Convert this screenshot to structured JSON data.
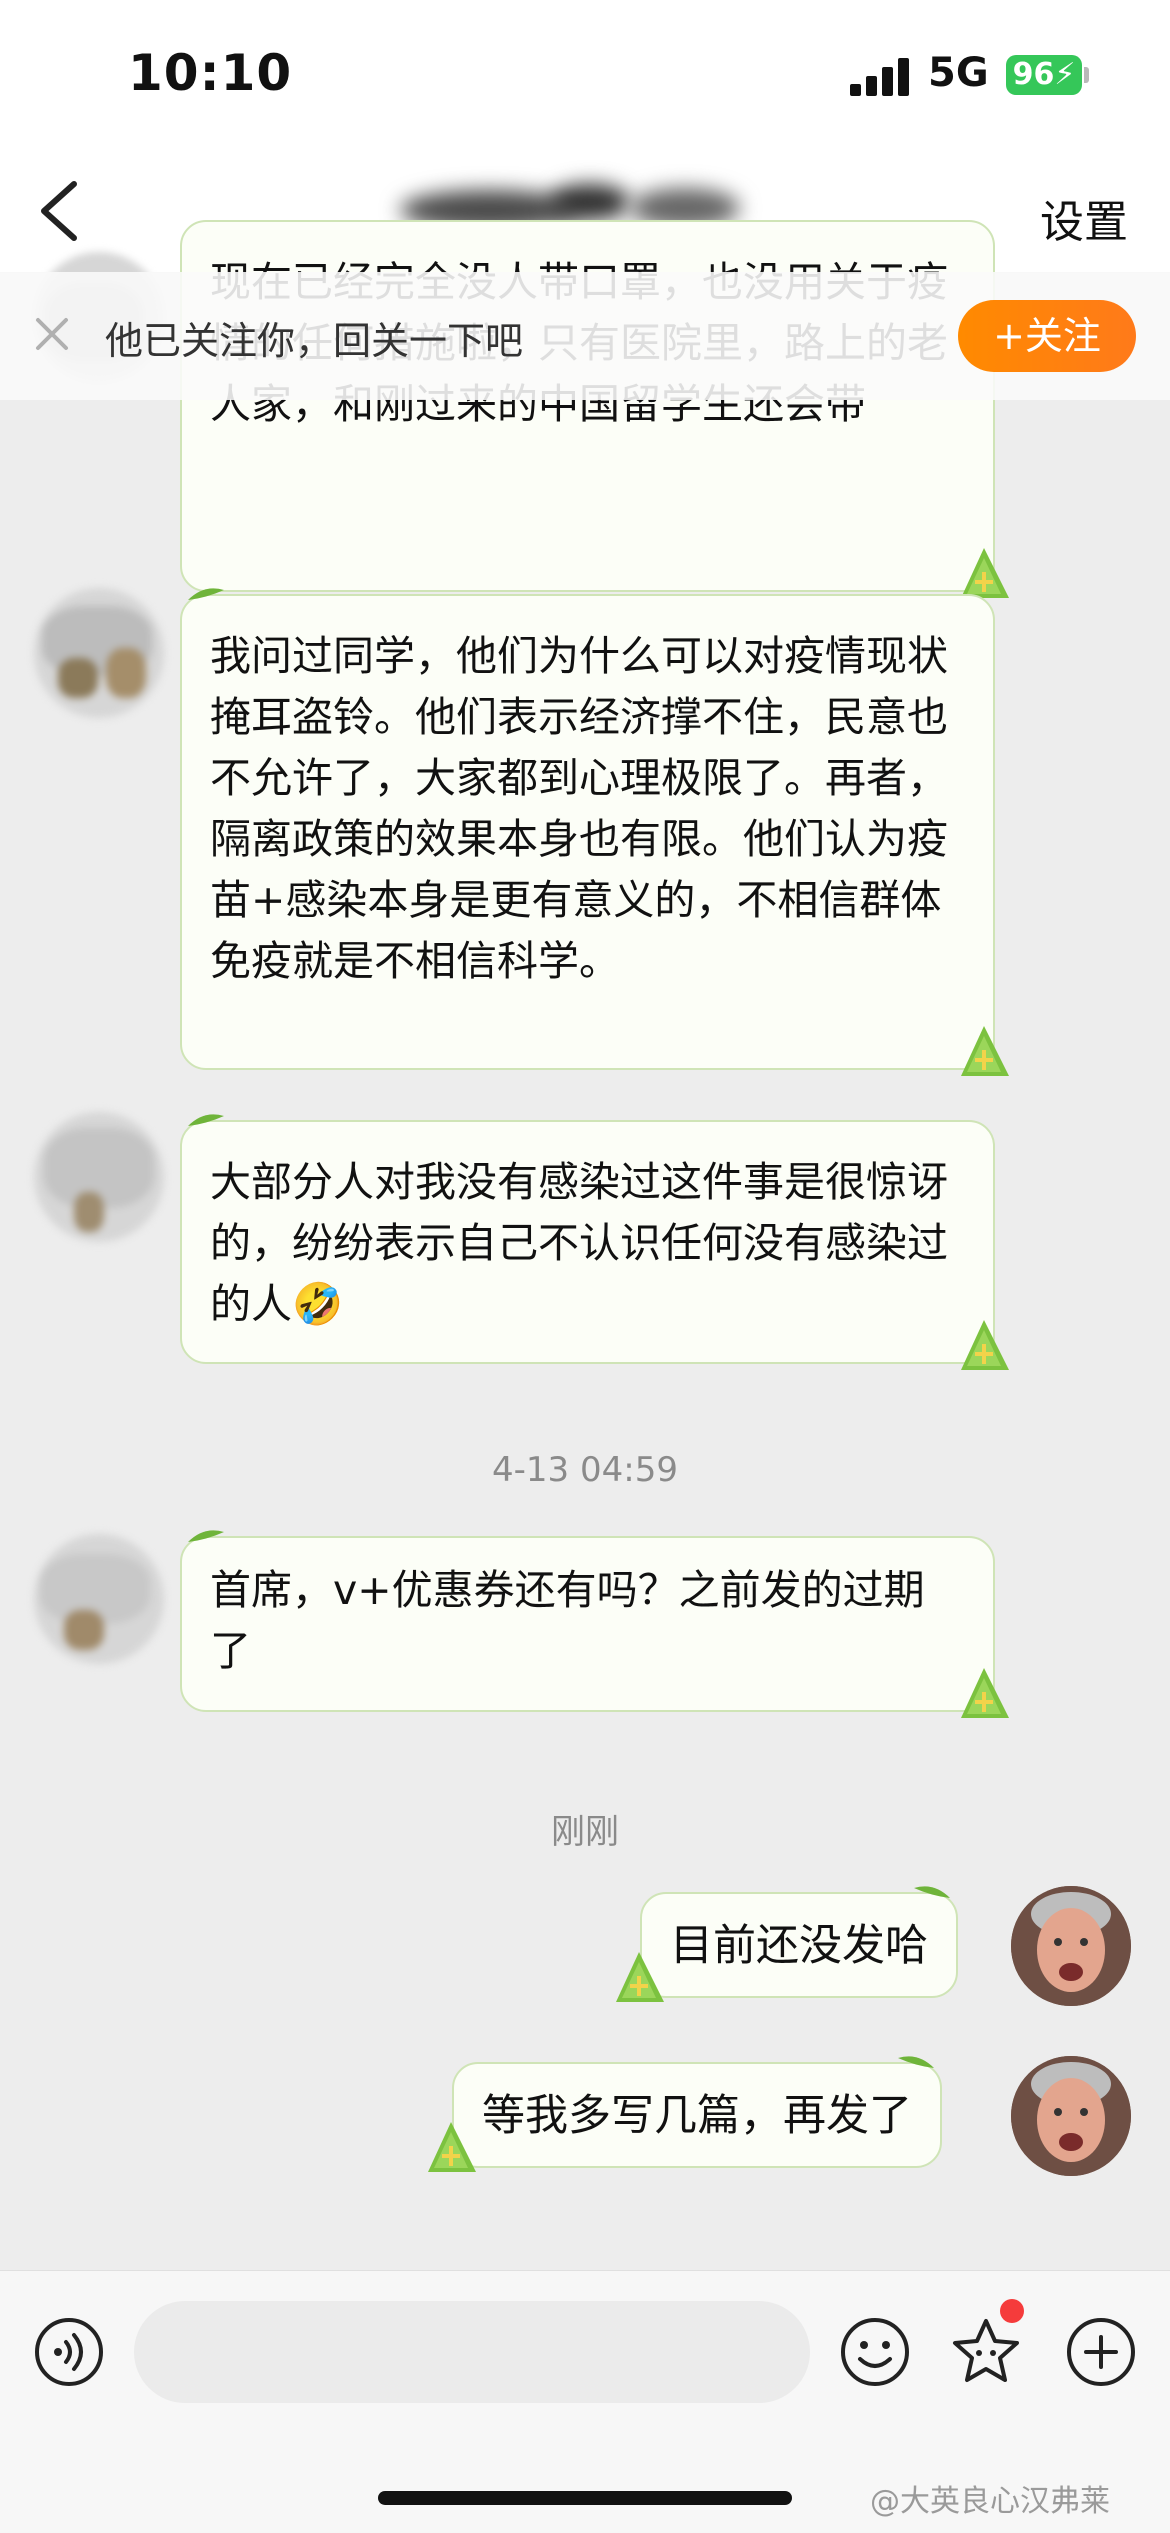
{
  "status_bar": {
    "time": "10:10",
    "network": "5G",
    "battery": "96"
  },
  "nav": {
    "settings_label": "设置"
  },
  "follow_banner": {
    "text": "他已关注你，回关一下吧",
    "follow_button": "+关注"
  },
  "messages_in": [
    {
      "text": "现在已经完全没人带口罩，也没用关于疫情的任何措施啦，只有医院里，路上的老人家，和刚过来的中国留学生还会带"
    },
    {
      "text": "我问过同学，他们为什么可以对疫情现状掩耳盗铃。他们表示经济撑不住，民意也不允许了，大家都到心理极限了。再者，隔离政策的效果本身也有限。他们认为疫苗+感染本身是更有意义的，不相信群体免疫就是不相信科学。"
    },
    {
      "text": "大部分人对我没有感染过这件事是很惊讶的，纷纷表示自己不认识任何没有感染过的人🤣"
    },
    {
      "text": "首席，v+优惠券还有吗？之前发的过期了"
    }
  ],
  "timestamps": [
    "4-13 04:59",
    "刚刚"
  ],
  "messages_out": [
    {
      "text": "目前还没发哈"
    },
    {
      "text": "等我多写几篇，再发了"
    }
  ],
  "input": {
    "placeholder": ""
  },
  "watermark": "@大英良心汉弗莱",
  "colors": {
    "bubble_bg": "#fcfef7",
    "bubble_border": "#cfe4b6",
    "follow_orange": "#ff8a00",
    "battery_green": "#35c759"
  }
}
